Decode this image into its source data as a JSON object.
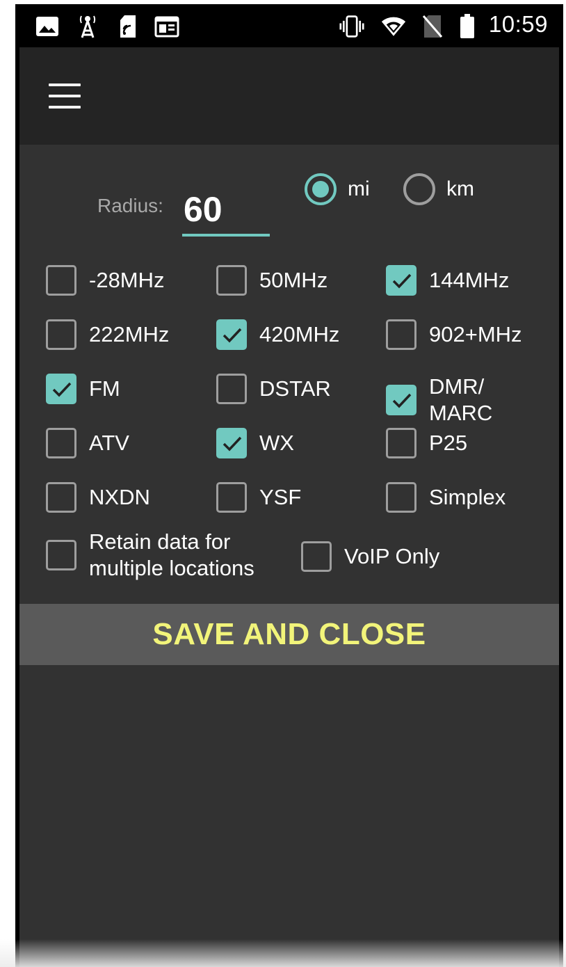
{
  "status_bar": {
    "time": "10:59",
    "left_icons": [
      "image-icon",
      "antenna-tower-icon",
      "sim-nfc-icon",
      "calendar-icon"
    ],
    "right_icons": [
      "vibrate-icon",
      "wifi-icon",
      "no-sim-icon",
      "battery-icon"
    ]
  },
  "toolbar": {
    "menu_icon": "hamburger-menu-icon"
  },
  "radius": {
    "label": "Radius:",
    "value": "60"
  },
  "units": {
    "selected": "mi",
    "options": [
      {
        "label": "mi",
        "checked": true
      },
      {
        "label": "km",
        "checked": false
      }
    ]
  },
  "filters": [
    {
      "label": "-28MHz",
      "checked": false
    },
    {
      "label": "50MHz",
      "checked": false
    },
    {
      "label": "144MHz",
      "checked": true
    },
    {
      "label": "222MHz",
      "checked": false
    },
    {
      "label": "420MHz",
      "checked": true
    },
    {
      "label": "902+MHz",
      "checked": false
    },
    {
      "label": "FM",
      "checked": true
    },
    {
      "label": "DSTAR",
      "checked": false
    },
    {
      "label": "DMR/ MARC",
      "checked": true
    },
    {
      "label": "ATV",
      "checked": false
    },
    {
      "label": "WX",
      "checked": true
    },
    {
      "label": "P25",
      "checked": false
    },
    {
      "label": "NXDN",
      "checked": false
    },
    {
      "label": "YSF",
      "checked": false
    },
    {
      "label": "Simplex",
      "checked": false
    }
  ],
  "options": {
    "retain": {
      "label_line1": "Retain data for",
      "label_line2": "multiple locations",
      "checked": false
    },
    "voip": {
      "label": "VoIP Only",
      "checked": false
    }
  },
  "save_button": {
    "label": "SAVE AND CLOSE"
  },
  "colors": {
    "accent": "#71c9c0",
    "save_text": "#f2f47a",
    "background": "#323232",
    "toolbar": "#242424"
  }
}
